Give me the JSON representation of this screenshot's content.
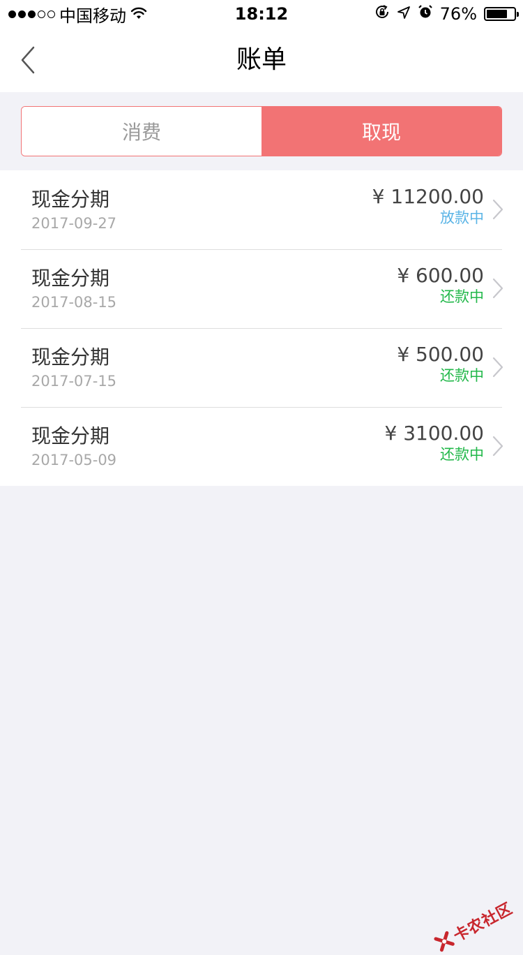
{
  "status_bar": {
    "carrier": "中国移动",
    "time": "18:12",
    "battery_text": "76%",
    "battery_level": 0.76,
    "signal_bars_filled": 3,
    "signal_bars_total": 5,
    "icons": [
      "wifi-icon",
      "rotation-lock-icon",
      "location-arrow-icon",
      "alarm-icon",
      "battery-icon"
    ]
  },
  "nav": {
    "title": "账单",
    "back_icon": "chevron-left-icon"
  },
  "tabs": [
    {
      "label": "消费",
      "active": false
    },
    {
      "label": "取现",
      "active": true
    }
  ],
  "bills": [
    {
      "title": "现金分期",
      "date": "2017-09-27",
      "amount": "¥ 11200.00",
      "status": "放款中",
      "status_type": "lending"
    },
    {
      "title": "现金分期",
      "date": "2017-08-15",
      "amount": "¥ 600.00",
      "status": "还款中",
      "status_type": "repaying"
    },
    {
      "title": "现金分期",
      "date": "2017-07-15",
      "amount": "¥ 500.00",
      "status": "还款中",
      "status_type": "repaying"
    },
    {
      "title": "现金分期",
      "date": "2017-05-09",
      "amount": "¥ 3100.00",
      "status": "还款中",
      "status_type": "repaying"
    }
  ],
  "watermark": {
    "text": "卡农社区"
  },
  "colors": {
    "accent": "#f27374",
    "lending": "#5ab4e6",
    "repaying": "#22b84a",
    "background": "#f2f2f7"
  }
}
